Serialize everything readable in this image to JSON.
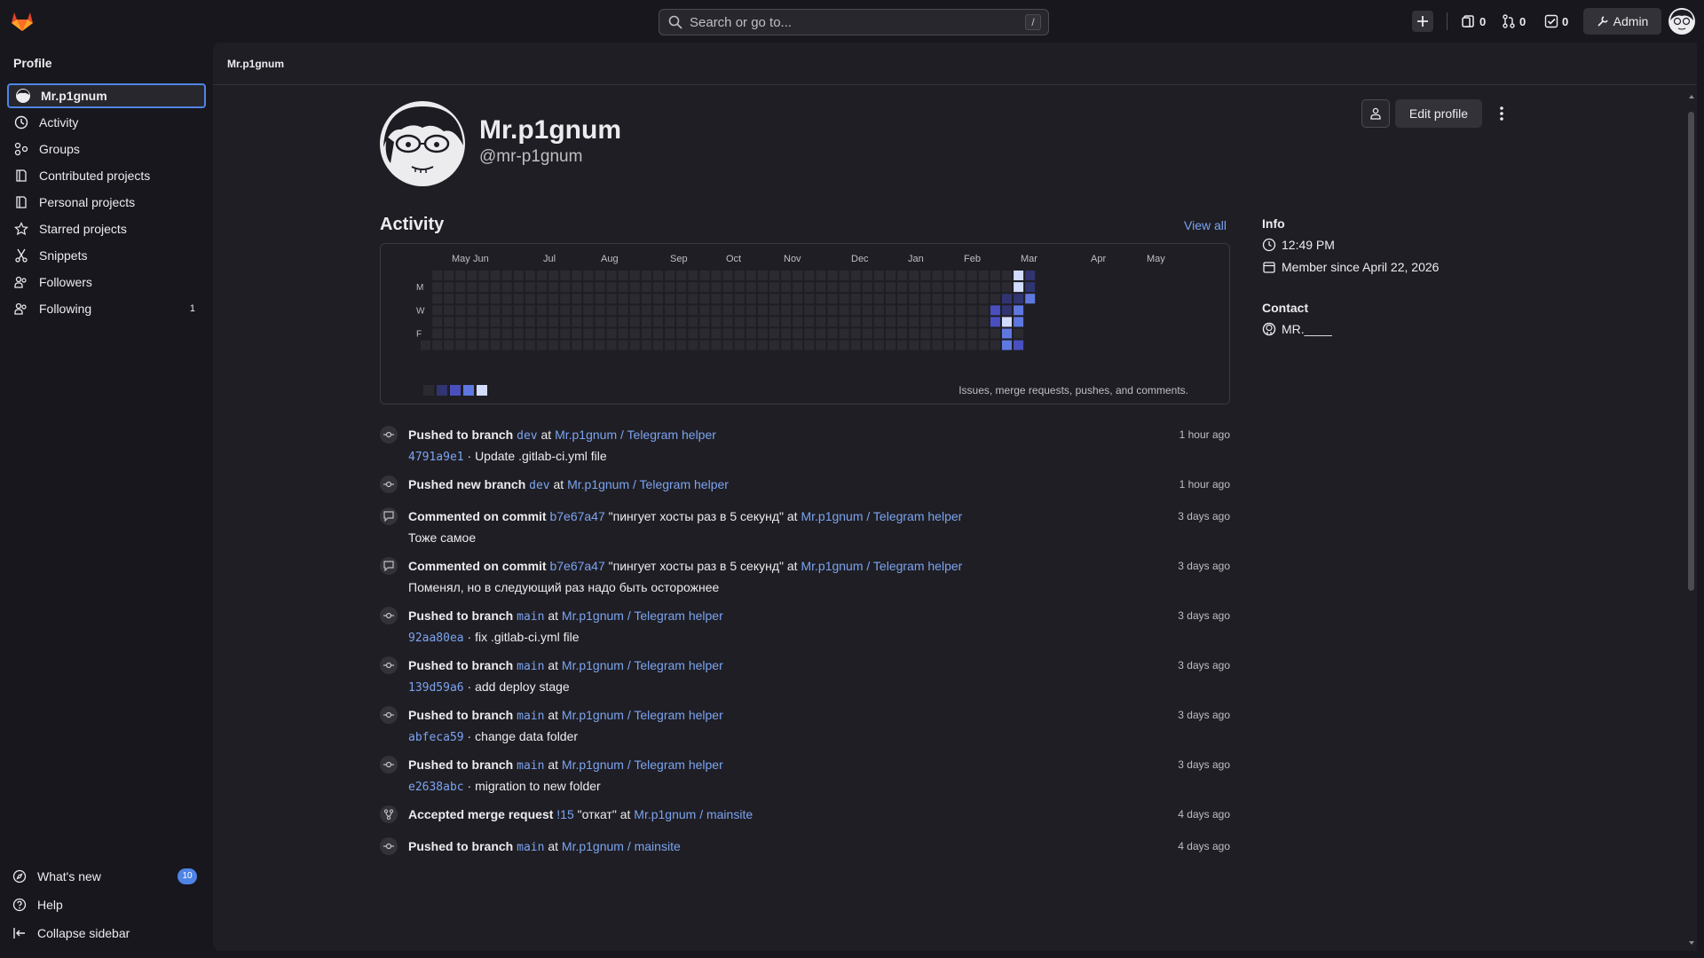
{
  "topbar": {
    "search_placeholder": "Search or go to...",
    "search_shortcut": "/",
    "issues_count": "0",
    "merge_requests_count": "0",
    "todos_count": "0",
    "admin_label": "Admin"
  },
  "sidebar": {
    "title": "Profile",
    "items": [
      {
        "label": "Mr.p1gnum",
        "icon": "avatar"
      },
      {
        "label": "Activity",
        "icon": "history-icon"
      },
      {
        "label": "Groups",
        "icon": "group-icon"
      },
      {
        "label": "Contributed projects",
        "icon": "project-icon"
      },
      {
        "label": "Personal projects",
        "icon": "project-icon"
      },
      {
        "label": "Starred projects",
        "icon": "star-icon"
      },
      {
        "label": "Snippets",
        "icon": "snippet-icon"
      },
      {
        "label": "Followers",
        "icon": "users-icon"
      },
      {
        "label": "Following",
        "icon": "users-icon",
        "count": "1"
      }
    ],
    "whats_new": "What's new",
    "whats_new_count": "10",
    "help": "Help",
    "collapse": "Collapse sidebar"
  },
  "breadcrumb": "Mr.p1gnum",
  "profile": {
    "name": "Mr.p1gnum",
    "handle": "@mr-p1gnum",
    "edit_label": "Edit profile"
  },
  "activity": {
    "title": "Activity",
    "view_all": "View all",
    "months": [
      "May",
      "Jun",
      "Jul",
      "Aug",
      "Sep",
      "Oct",
      "Nov",
      "Dec",
      "Jan",
      "Feb",
      "Mar",
      "Apr",
      "May"
    ],
    "weekdays": [
      "M",
      "W",
      "F"
    ],
    "legend_text": "Issues, merge requests, pushes, and comments.",
    "colors": {
      "empty": "#2b2a30",
      "l1": "#303470",
      "l2": "#4a4fc0",
      "l3": "#5f78e0",
      "l4": "#d2dcff"
    }
  },
  "info": {
    "heading": "Info",
    "time": "12:49 PM",
    "member_since": "Member since April 22, 2026",
    "contact_heading": "Contact",
    "contact": "MR.____"
  },
  "events": [
    {
      "type": "push",
      "action": "Pushed to branch",
      "branch": "dev",
      "at": "at",
      "project": "Mr.p1gnum / Telegram helper",
      "sha": "4791a9e1",
      "message": "· Update .gitlab-ci.yml file",
      "time": "1 hour ago"
    },
    {
      "type": "push",
      "action": "Pushed new branch",
      "branch": "dev",
      "at": "at",
      "project": "Mr.p1gnum / Telegram helper",
      "sha": "",
      "message": "",
      "time": "1 hour ago"
    },
    {
      "type": "comment",
      "action": "Commented on commit",
      "branch": "b7e67a47",
      "title": "\"пингует хосты раз в 5 секунд\"",
      "at": "at",
      "project": "Mr.p1gnum / Telegram helper",
      "message": "Тоже самое",
      "time": "3 days ago"
    },
    {
      "type": "comment",
      "action": "Commented on commit",
      "branch": "b7e67a47",
      "title": "\"пингует хосты раз в 5 секунд\"",
      "at": "at",
      "project": "Mr.p1gnum / Telegram helper",
      "message": "Поменял, но в следующий раз надо быть осторожнее",
      "time": "3 days ago"
    },
    {
      "type": "push",
      "action": "Pushed to branch",
      "branch": "main",
      "at": "at",
      "project": "Mr.p1gnum / Telegram helper",
      "sha": "92aa80ea",
      "message": "· fix .gitlab-ci.yml file",
      "time": "3 days ago"
    },
    {
      "type": "push",
      "action": "Pushed to branch",
      "branch": "main",
      "at": "at",
      "project": "Mr.p1gnum / Telegram helper",
      "sha": "139d59a6",
      "message": "· add deploy stage",
      "time": "3 days ago"
    },
    {
      "type": "push",
      "action": "Pushed to branch",
      "branch": "main",
      "at": "at",
      "project": "Mr.p1gnum / Telegram helper",
      "sha": "abfeca59",
      "message": "· change data folder",
      "time": "3 days ago"
    },
    {
      "type": "push",
      "action": "Pushed to branch",
      "branch": "main",
      "at": "at",
      "project": "Mr.p1gnum / Telegram helper",
      "sha": "e2638abc",
      "message": "· migration to new folder",
      "time": "3 days ago"
    },
    {
      "type": "merge",
      "action": "Accepted merge request",
      "branch": "!15",
      "title": "\"откат\"",
      "at": "at",
      "project": "Mr.p1gnum / mainsite",
      "message": "",
      "time": "4 days ago"
    },
    {
      "type": "push",
      "action": "Pushed to branch",
      "branch": "main",
      "at": "at",
      "project": "Mr.p1gnum / mainsite",
      "sha": "",
      "message": "",
      "time": "4 days ago"
    }
  ]
}
